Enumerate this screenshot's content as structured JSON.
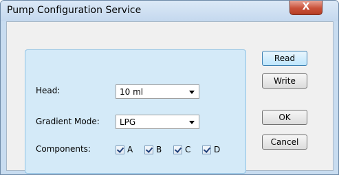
{
  "window": {
    "title": "Pump Configuration Service",
    "close_glyph": "X"
  },
  "form": {
    "head_label": "Head:",
    "head_value": "10 ml",
    "gradient_label": "Gradient Mode:",
    "gradient_value": "LPG",
    "components_label": "Components:",
    "components": [
      {
        "label": "A",
        "checked": true
      },
      {
        "label": "B",
        "checked": true
      },
      {
        "label": "C",
        "checked": true
      },
      {
        "label": "D",
        "checked": true
      }
    ]
  },
  "buttons": {
    "read": "Read",
    "write": "Write",
    "ok": "OK",
    "cancel": "Cancel"
  },
  "colors": {
    "group_fill": "#d4eaf8",
    "close_button": "#c9513a"
  },
  "icons": {
    "close": "close-icon",
    "combo_arrow": "chevron-down-icon",
    "check": "checkmark-icon"
  }
}
